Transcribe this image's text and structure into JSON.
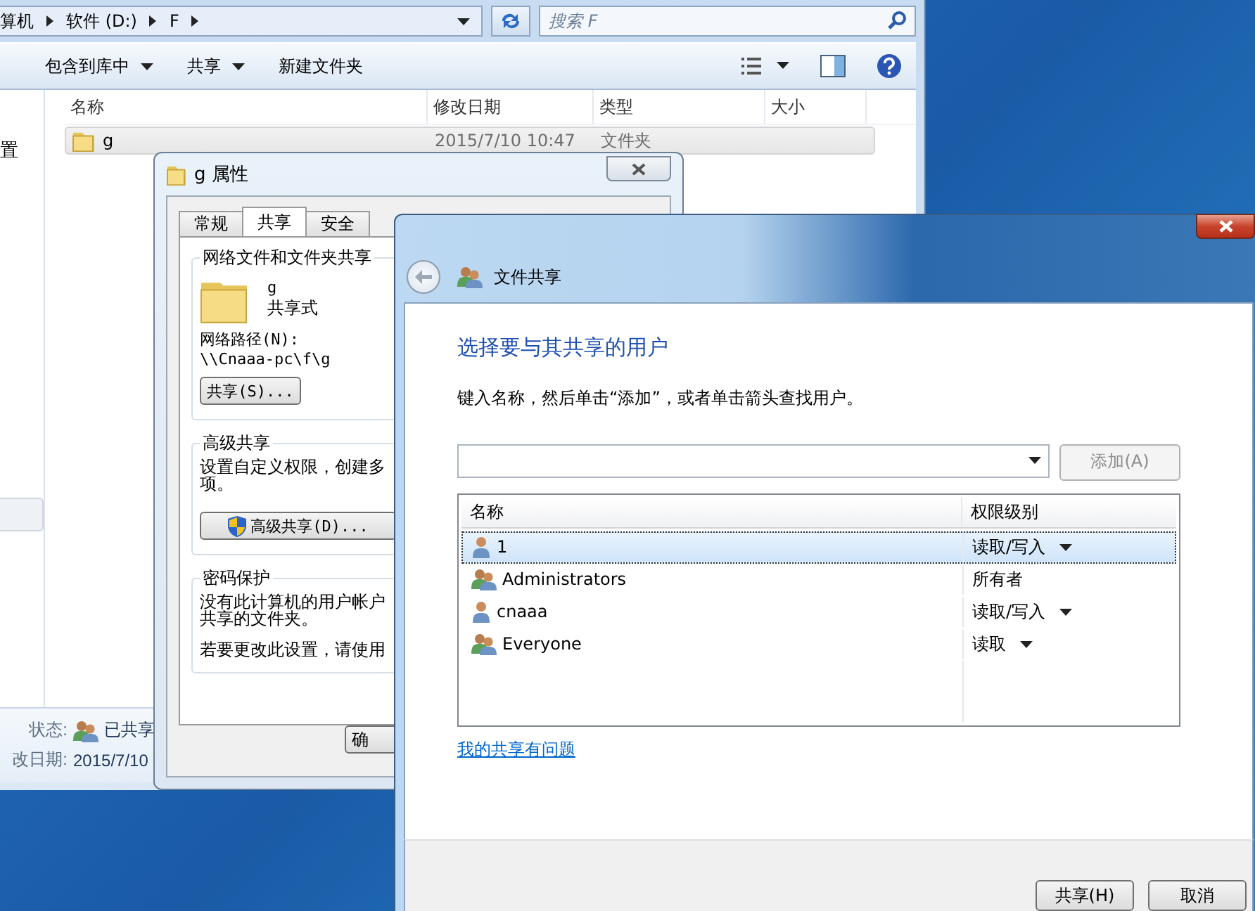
{
  "explorer": {
    "breadcrumb": [
      "算机",
      "软件 (D:)",
      "F"
    ],
    "search": {
      "placeholder": "搜索 F"
    },
    "toolbar": [
      {
        "label": "包含到库中",
        "dropdown": true
      },
      {
        "label": "共享",
        "dropdown": true
      },
      {
        "label": "新建文件夹",
        "dropdown": false
      }
    ],
    "nav_fragment": "置",
    "columns": [
      "名称",
      "修改日期",
      "类型",
      "大小"
    ],
    "files": [
      {
        "name": "g",
        "modified": "2015/7/10 10:47",
        "type": "文件夹",
        "selected": true
      }
    ],
    "details": [
      {
        "label": "状态:",
        "value": "已共享",
        "kind": "shared"
      },
      {
        "label": "改日期:",
        "value": "2015/7/10",
        "kind": "plain"
      }
    ]
  },
  "properties": {
    "title": "g 属性",
    "tabs": [
      {
        "label": "常规",
        "selected": false
      },
      {
        "label": "共享",
        "selected": true
      },
      {
        "label": "安全",
        "selected": false
      }
    ],
    "network_sharing": {
      "heading": "网络文件和文件夹共享",
      "folder_name": "g",
      "folder_status": "共享式",
      "path_label": "网络路径(N):",
      "path": "\\\\Cnaaa-pc\\f\\g",
      "button": "共享(S)..."
    },
    "advanced_sharing": {
      "heading": "高级共享",
      "lines": [
        "设置自定义权限，创建多",
        "项。"
      ],
      "button": "高级共享(D)..."
    },
    "password_protection": {
      "heading": "密码保护",
      "lines": [
        "没有此计算机的用户帐户",
        "共享的文件夹。"
      ],
      "note": "若要更改此设置，请使用"
    },
    "ok_button": "确"
  },
  "sharing": {
    "title": "文件共享",
    "heading": "选择要与其共享的用户",
    "instruction": "键入名称，然后单击“添加”，或者单击箭头查找用户。",
    "add_button": {
      "label": "添加(A)",
      "disabled": true
    },
    "columns": [
      "名称",
      "权限级别"
    ],
    "rows": [
      {
        "name": "1",
        "kind": "user",
        "permission": "读取/写入",
        "dropdown": true,
        "selected": true
      },
      {
        "name": "Administrators",
        "kind": "group",
        "permission": "所有者",
        "dropdown": false,
        "selected": false
      },
      {
        "name": "cnaaa",
        "kind": "user",
        "permission": "读取/写入",
        "dropdown": true,
        "selected": false
      },
      {
        "name": "Everyone",
        "kind": "group",
        "permission": "读取",
        "dropdown": true,
        "selected": false
      }
    ],
    "help_link": "我的共享有问题",
    "buttons": [
      "共享(H)",
      "取消"
    ]
  }
}
